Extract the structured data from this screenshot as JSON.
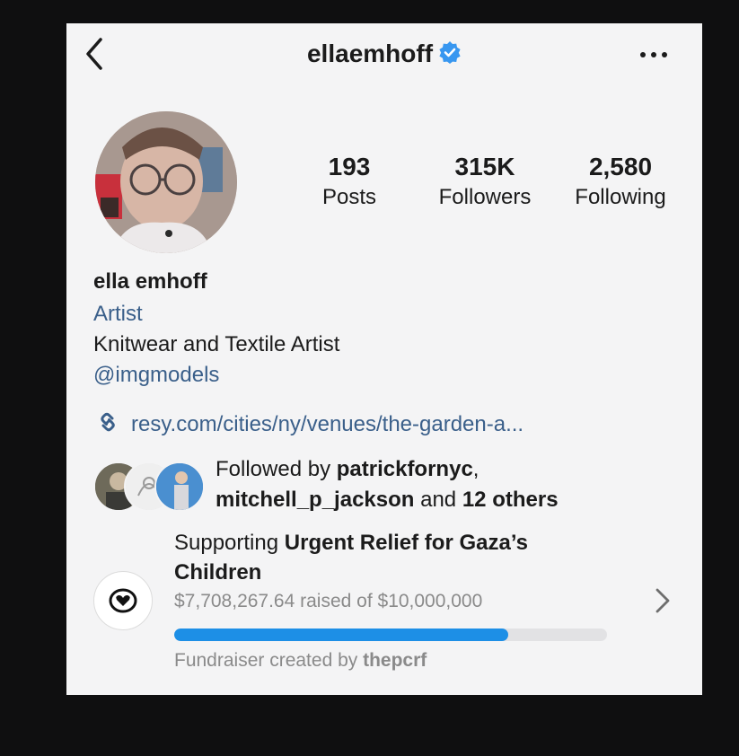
{
  "header": {
    "username": "ellaemhoff",
    "verified": true,
    "back_icon": "chevron-left-icon",
    "more_icon": "more-horizontal-icon"
  },
  "stats": [
    {
      "value": "193",
      "label": "Posts"
    },
    {
      "value": "315K",
      "label": "Followers"
    },
    {
      "value": "2,580",
      "label": "Following"
    }
  ],
  "profile": {
    "display_name": "ella emhoff",
    "category": "Artist",
    "bio": "Knitwear and Textile Artist",
    "mention": "@imgmodels",
    "link": "resy.com/cities/ny/venues/the-garden-a..."
  },
  "followed_by": {
    "prefix": "Followed by ",
    "user1": "patrickfornyc",
    "sep": ",",
    "user2": "mitchell_p_jackson",
    "mid": " and ",
    "others": "12 others"
  },
  "fundraiser": {
    "supporting": "Supporting ",
    "cause": "Urgent Relief for Gaza’s Children",
    "raised_text": "$7,708,267.64 raised of $10,000,000",
    "progress_fraction": 0.7708,
    "creator_prefix": "Fundraiser created by ",
    "creator": "thepcrf"
  },
  "colors": {
    "link_blue": "#3a5f8a",
    "verified_blue": "#3897f0",
    "progress_blue": "#1d8fe6"
  }
}
